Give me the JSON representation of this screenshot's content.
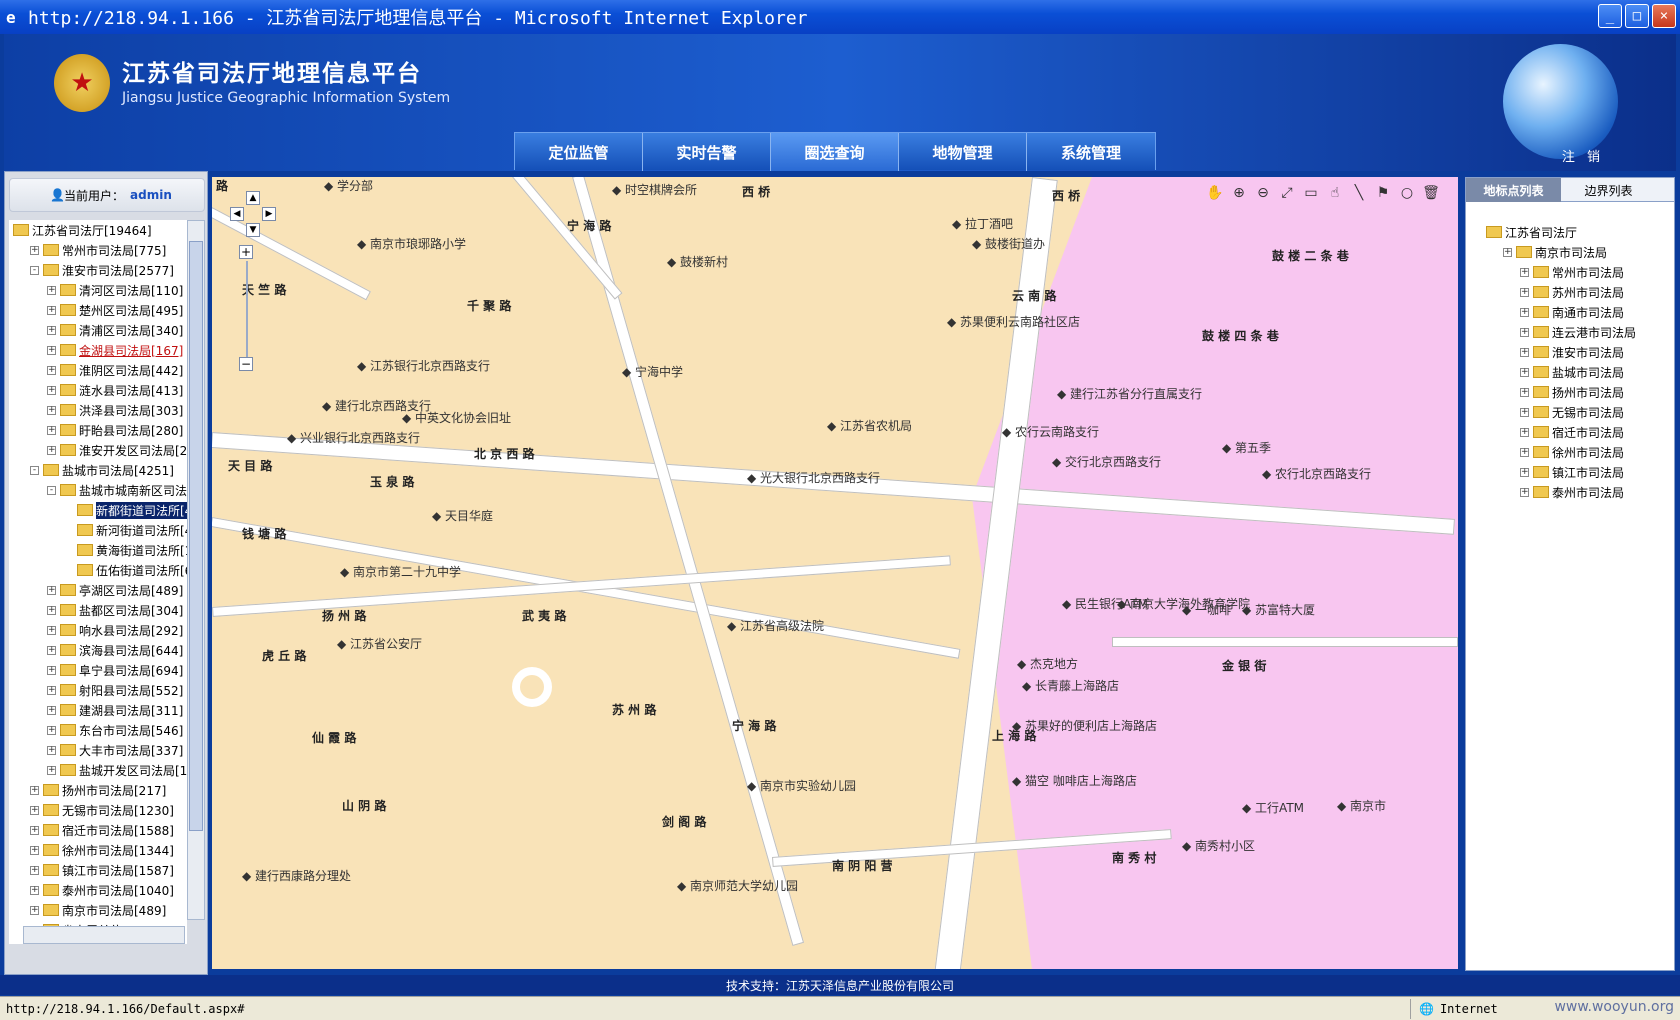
{
  "window": {
    "title": "http://218.94.1.166 - 江苏省司法厅地理信息平台 - Microsoft Internet Explorer"
  },
  "header": {
    "title_cn": "江苏省司法厅地理信息平台",
    "title_en": "Jiangsu Justice Geographic Information System",
    "logout": "注 销"
  },
  "nav": [
    "定位监管",
    "实时告警",
    "圈选查询",
    "地物管理",
    "系统管理"
  ],
  "nav_active": 2,
  "user": {
    "label": "当前用户：",
    "name": "admin"
  },
  "tree": [
    {
      "label": "江苏省司法厅[19464]",
      "level": 0,
      "pm": ""
    },
    {
      "label": "常州市司法局[775]",
      "level": 1,
      "pm": "+"
    },
    {
      "label": "淮安市司法局[2577]",
      "level": 1,
      "pm": "-"
    },
    {
      "label": "清河区司法局[110]",
      "level": 2,
      "pm": "+"
    },
    {
      "label": "楚州区司法局[495]",
      "level": 2,
      "pm": "+"
    },
    {
      "label": "清浦区司法局[340]",
      "level": 2,
      "pm": "+"
    },
    {
      "label": "金湖县司法局[167]",
      "level": 2,
      "pm": "+",
      "style": "red"
    },
    {
      "label": "淮阴区司法局[442]",
      "level": 2,
      "pm": "+"
    },
    {
      "label": "涟水县司法局[413]",
      "level": 2,
      "pm": "+"
    },
    {
      "label": "洪泽县司法局[303]",
      "level": 2,
      "pm": "+"
    },
    {
      "label": "盱眙县司法局[280]",
      "level": 2,
      "pm": "+"
    },
    {
      "label": "淮安开发区司法局[2",
      "level": 2,
      "pm": "+"
    },
    {
      "label": "盐城市司法局[4251]",
      "level": 1,
      "pm": "-"
    },
    {
      "label": "盐城市城南新区司法",
      "level": 2,
      "pm": "-"
    },
    {
      "label": "新都街道司法所[4",
      "level": 3,
      "pm": "",
      "style": "sel"
    },
    {
      "label": "新河街道司法所[4",
      "level": 3,
      "pm": ""
    },
    {
      "label": "黄海街道司法所[1",
      "level": 3,
      "pm": ""
    },
    {
      "label": "伍佑街道司法所[6",
      "level": 3,
      "pm": ""
    },
    {
      "label": "亭湖区司法局[489]",
      "level": 2,
      "pm": "+"
    },
    {
      "label": "盐都区司法局[304]",
      "level": 2,
      "pm": "+"
    },
    {
      "label": "响水县司法局[292]",
      "level": 2,
      "pm": "+"
    },
    {
      "label": "滨海县司法局[644]",
      "level": 2,
      "pm": "+"
    },
    {
      "label": "阜宁县司法局[694]",
      "level": 2,
      "pm": "+"
    },
    {
      "label": "射阳县司法局[552]",
      "level": 2,
      "pm": "+"
    },
    {
      "label": "建湖县司法局[311]",
      "level": 2,
      "pm": "+"
    },
    {
      "label": "东台市司法局[546]",
      "level": 2,
      "pm": "+"
    },
    {
      "label": "大丰市司法局[337]",
      "level": 2,
      "pm": "+"
    },
    {
      "label": "盐城开发区司法局[1",
      "level": 2,
      "pm": "+"
    },
    {
      "label": "扬州市司法局[217]",
      "level": 1,
      "pm": "+"
    },
    {
      "label": "无锡市司法局[1230]",
      "level": 1,
      "pm": "+"
    },
    {
      "label": "宿迁市司法局[1588]",
      "level": 1,
      "pm": "+"
    },
    {
      "label": "徐州市司法局[1344]",
      "level": 1,
      "pm": "+"
    },
    {
      "label": "镇江市司法局[1587]",
      "level": 1,
      "pm": "+"
    },
    {
      "label": "泰州市司法局[1040]",
      "level": 1,
      "pm": "+"
    },
    {
      "label": "南京市司法局[489]",
      "level": 1,
      "pm": "+"
    },
    {
      "label": "省直属单位",
      "level": 1,
      "pm": "+"
    }
  ],
  "right_tabs": [
    "地标点列表",
    "边界列表"
  ],
  "right_tree": [
    {
      "label": "江苏省司法厅",
      "level": 0
    },
    {
      "label": "南京市司法局",
      "level": 1
    },
    {
      "label": "常州市司法局",
      "level": 2
    },
    {
      "label": "苏州市司法局",
      "level": 2
    },
    {
      "label": "南通市司法局",
      "level": 2
    },
    {
      "label": "连云港市司法局",
      "level": 2
    },
    {
      "label": "淮安市司法局",
      "level": 2
    },
    {
      "label": "盐城市司法局",
      "level": 2
    },
    {
      "label": "扬州市司法局",
      "level": 2
    },
    {
      "label": "无锡市司法局",
      "level": 2
    },
    {
      "label": "宿迁市司法局",
      "level": 2
    },
    {
      "label": "徐州市司法局",
      "level": 2
    },
    {
      "label": "镇江市司法局",
      "level": 2
    },
    {
      "label": "泰州市司法局",
      "level": 2
    }
  ],
  "map_tools": [
    "hand-icon",
    "zoom-in-icon",
    "zoom-out-icon",
    "full-extent-icon",
    "measure-icon",
    "select-icon",
    "line-icon",
    "flag-icon",
    "circle-icon",
    "clear-icon"
  ],
  "map_labels": {
    "roads": [
      "路",
      "西 桥",
      "宁 海 路",
      "天 竺 路",
      "千 聚 路",
      "北 京 西 路",
      "天 目 路",
      "玉 泉 路",
      "钱 塘 路",
      "扬 州 路",
      "虎 丘 路",
      "武 夷 路",
      "苏 州 路",
      "仙 霞 路",
      "山 阴 路",
      "剑 阁 路",
      "南 阴 阳 营",
      "南 秀 村",
      "宁 海 路",
      "云 南 路",
      "鼓 楼 四 条 巷",
      "鼓 楼 二 条 巷",
      "金 银 街",
      "上 海 路",
      "西 桥"
    ],
    "pois": [
      "学分部",
      "时空棋牌会所",
      "南京市琅琊路小学",
      "鼓楼新村",
      "拉丁酒吧",
      "鼓楼街道办",
      "苏果便利云南路社区店",
      "宁海中学",
      "江苏银行北京西路支行",
      "建行北京西路支行",
      "中英文化协会旧址",
      "兴业银行北京西路支行",
      "江苏省农机局",
      "建行江苏省分行直属支行",
      "农行云南路支行",
      "交行北京西路支行",
      "第五季",
      "农行北京西路支行",
      "光大银行北京西路支行",
      "天目华庭",
      "南京市第二十九中学",
      "江苏省高级法院",
      "江苏省公安厅",
      "民生银行ATM",
      "南京大学海外教育学院",
      "一咖啡",
      "苏富特大厦",
      "杰克地方",
      "长青藤上海路店",
      "苏果好的便利店上海路店",
      "猫空 咖啡店上海路店",
      "南京市实验幼儿园",
      "工行ATM",
      "南秀村小区",
      "南京师范大学幼儿园",
      "建行西康路分理处",
      "南京市"
    ]
  },
  "footer": "技术支持：江苏天泽信息产业股份有限公司",
  "status": {
    "url": "http://218.94.1.166/Default.aspx#",
    "zone": "Internet",
    "watermark": "www.wooyun.org"
  }
}
